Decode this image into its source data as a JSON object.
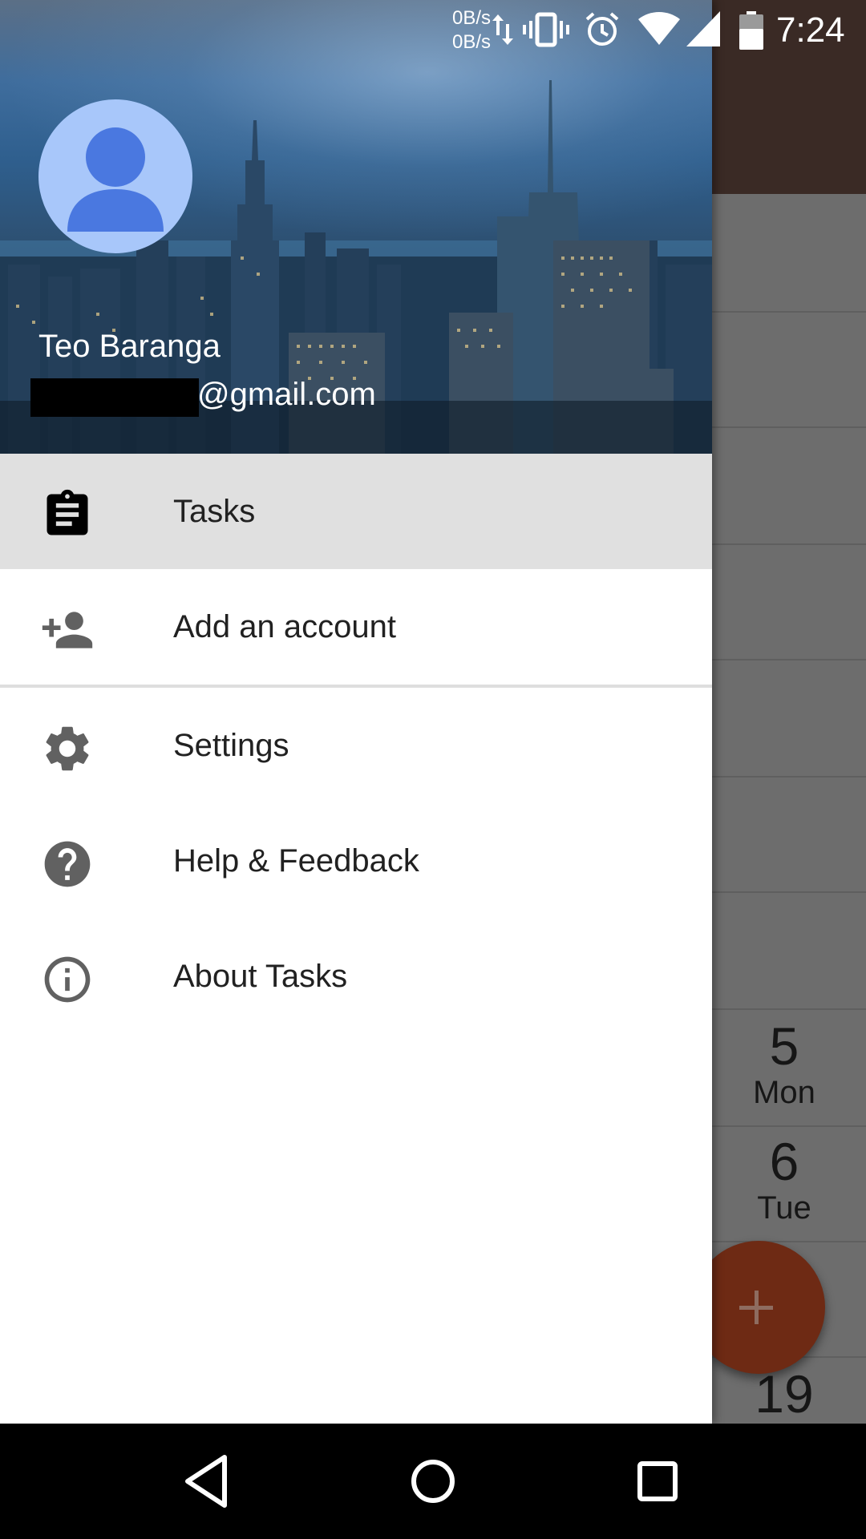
{
  "status_bar": {
    "net_up": "0B/s",
    "net_down": "0B/s",
    "time": "7:24",
    "icons": [
      "data-transfer-icon",
      "vibrate-icon",
      "alarm-icon",
      "wifi-icon",
      "cell-signal-icon",
      "battery-icon"
    ]
  },
  "drawer": {
    "header": {
      "name": "Teo Baranga",
      "email": "@gmail.com"
    },
    "items": [
      {
        "label": "Tasks",
        "icon": "clipboard-icon",
        "selected": true
      },
      {
        "label": "Add an account",
        "icon": "add-person-icon",
        "selected": false
      },
      {
        "label": "Settings",
        "icon": "gear-icon",
        "selected": false
      },
      {
        "label": "Help & Feedback",
        "icon": "help-icon",
        "selected": false
      },
      {
        "label": "About Tasks",
        "icon": "info-icon",
        "selected": false
      }
    ]
  },
  "background_calendar": {
    "days": [
      {
        "num": "5",
        "dow": "Mon"
      },
      {
        "num": "6",
        "dow": "Tue"
      },
      {
        "num": "19",
        "dow": ""
      }
    ]
  },
  "nav_bar": {
    "buttons": [
      "back-icon",
      "home-icon",
      "recents-icon"
    ]
  },
  "colors": {
    "drawer_selected_bg": "#e0e0e0",
    "fab": "#6e2a14",
    "avatar_bg": "#a8c7fa",
    "avatar_fg": "#4a78e0"
  }
}
